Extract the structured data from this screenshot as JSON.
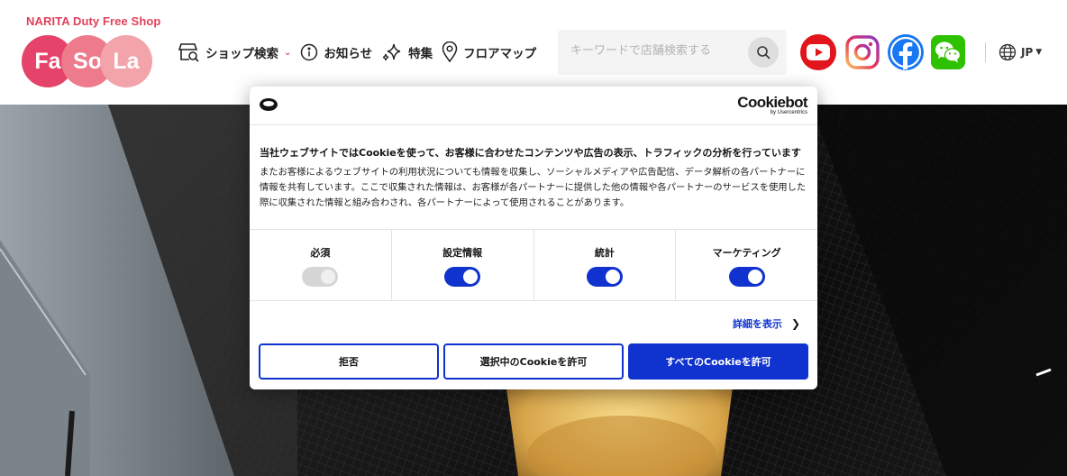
{
  "header": {
    "brand_text": "NARITA Duty Free Shop",
    "logo": [
      "Fa",
      "So",
      "La"
    ],
    "nav": [
      {
        "label": "ショップ検索",
        "icon": "shop-icon"
      },
      {
        "label": "お知らせ",
        "icon": "info-icon"
      },
      {
        "label": "特集",
        "icon": "sparkle-icon"
      },
      {
        "label": "フロアマップ",
        "icon": "map-pin-icon"
      }
    ],
    "search_placeholder": "キーワードで店舗検索する",
    "social": [
      "youtube-icon",
      "instagram-icon",
      "facebook-icon",
      "wechat-icon"
    ],
    "language": "JP"
  },
  "cookie": {
    "brand": "Cookiebot",
    "brand_sub": "by Usercentrics",
    "title": "当社ウェブサイトではCookieを使って、お客様に合わせたコンテンツや広告の表示、トラフィックの分析を行っています",
    "text": "またお客様によるウェブサイトの利用状況についても情報を収集し、ソーシャルメディアや広告配信、データ解析の各パートナーに情報を共有しています。ここで収集された情報は、お客様が各パートナーに提供した他の情報や各パートナーのサービスを使用した際に収集された情報と組み合わされ、各パートナーによって使用されることがあります。",
    "categories": [
      {
        "label": "必須",
        "enabled": true,
        "locked": true
      },
      {
        "label": "設定情報",
        "enabled": true
      },
      {
        "label": "統計",
        "enabled": true
      },
      {
        "label": "マーケティング",
        "enabled": true
      }
    ],
    "details_link": "詳細を表示",
    "buttons": {
      "deny": "拒否",
      "allow_selection": "選択中のCookieを許可",
      "allow_all": "すべてのCookieを許可"
    }
  },
  "colors": {
    "brand_pink": "#e0405a",
    "cookie_blue": "#1032cf"
  }
}
